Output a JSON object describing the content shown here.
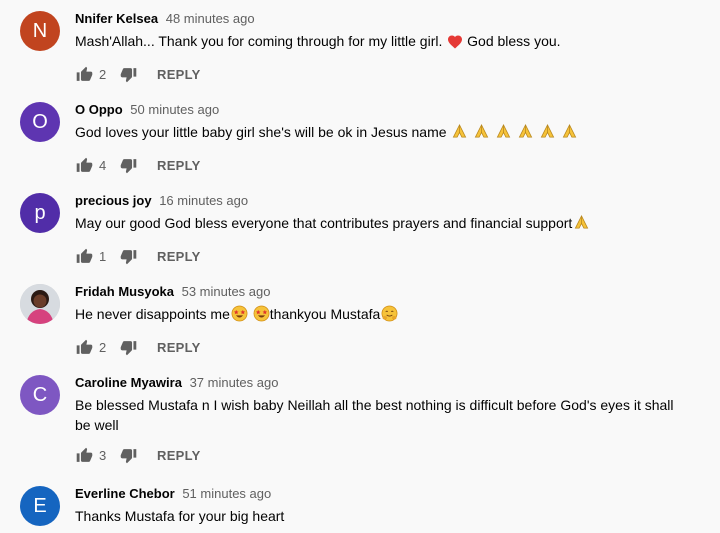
{
  "colors": {
    "avatar_n": "#c1441f",
    "avatar_o": "#5e35b1",
    "avatar_p": "#512da8",
    "avatar_c": "#7e57c2",
    "avatar_e": "#1565c0",
    "heart": "#e53935",
    "emoji_yellow": "#f6c33a"
  },
  "labels": {
    "reply": "REPLY"
  },
  "comments": [
    {
      "avatar_letter": "N",
      "author": "Nnifer Kelsea",
      "time": "48 minutes ago",
      "text_before": "Mash'Allah... Thank you for coming through for my little girl. ",
      "emoji": "heart-emoji",
      "text_after": " God bless you.",
      "likes": "2"
    },
    {
      "avatar_letter": "O",
      "author": "O Oppo",
      "time": "50 minutes ago",
      "text": "God loves your little baby girl she's will be ok in Jesus name ",
      "emoji": "folded-hands-emoji",
      "emoji_count": 6,
      "likes": "4"
    },
    {
      "avatar_letter": "p",
      "author": "precious joy",
      "time": "16 minutes ago",
      "text": "May our good God bless everyone that contributes prayers and financial support",
      "emoji": "folded-hands-emoji",
      "likes": "1"
    },
    {
      "avatar": "photo",
      "author": "Fridah Musyoka",
      "time": "53 minutes ago",
      "text_before": "He never disappoints me",
      "emoji": "star-struck-emoji",
      "text_after": "thankyou Mustafa",
      "emoji_end": "hugging-face-emoji",
      "likes": "2"
    },
    {
      "avatar_letter": "C",
      "author": "Caroline Myawira",
      "time": "37 minutes ago",
      "text": "Be blessed Mustafa n I wish baby Neillah all the best nothing is difficult before God's eyes it shall be well",
      "likes": "3"
    },
    {
      "avatar_letter": "E",
      "author": "Everline Chebor",
      "time": "51 minutes ago",
      "text": "Thanks Mustafa for your big heart"
    }
  ]
}
